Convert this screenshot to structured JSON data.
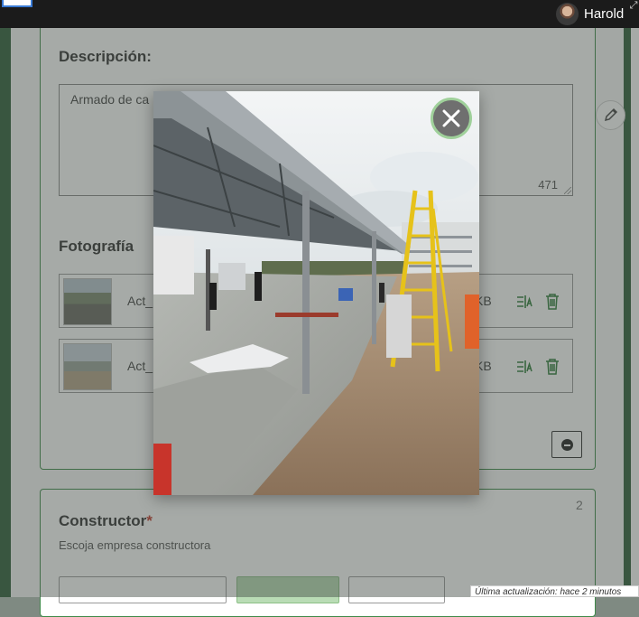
{
  "header": {
    "username": "Harold"
  },
  "form": {
    "description": {
      "label": "Descripción:",
      "value": "Armado de ca",
      "char_count": "471"
    },
    "photo": {
      "label": "Fotografía",
      "files": [
        {
          "name": "Act_",
          "size": "KB"
        },
        {
          "name": "Act_",
          "size": "KB"
        }
      ]
    },
    "constructor": {
      "label": "Constructor",
      "required_mark": "*",
      "hint": "Escoja empresa constructora",
      "count": "2"
    }
  },
  "footer": {
    "last_update": "Última actualización: hace 2 minutos"
  },
  "colors": {
    "accent_green": "#3f8a4a",
    "dark_rail": "#2f5e3a",
    "topbar": "#1b1b1b",
    "close_ring": "#9fd09a"
  },
  "icons": [
    "expand-icon",
    "pencil-icon",
    "rename-icon",
    "trash-icon",
    "minus-circle-icon",
    "close-icon"
  ]
}
